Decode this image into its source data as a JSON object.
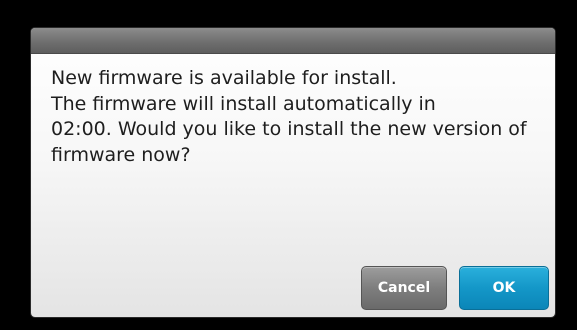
{
  "dialog": {
    "message_lines": [
      "New firmware is available for install.",
      "The firmware will install automatically in",
      "02:00. Would you like to install the new version of",
      "firmware now?"
    ],
    "cancel_label": "Cancel",
    "ok_label": "OK"
  },
  "colors": {
    "background": "#000000",
    "titlebar": "#6f6f6f",
    "cancel_button": "#7e7e7e",
    "ok_button": "#1497c8"
  }
}
